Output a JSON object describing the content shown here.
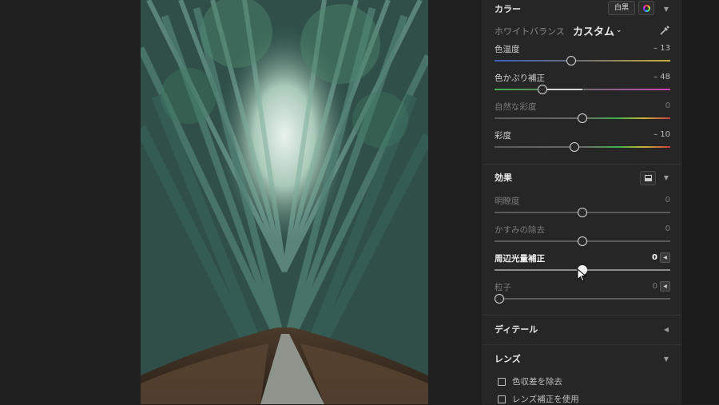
{
  "sections": {
    "color": {
      "title": "カラー",
      "bw_label": "白黒",
      "white_balance": {
        "label": "ホワイトバランス",
        "value": "カスタム"
      },
      "sliders": [
        {
          "label": "色温度",
          "value": "– 13"
        },
        {
          "label": "色かぶり補正",
          "value": "– 48"
        },
        {
          "label": "自然な彩度",
          "value": "0"
        },
        {
          "label": "彩度",
          "value": "– 10"
        }
      ]
    },
    "effects": {
      "title": "効果",
      "sliders": [
        {
          "label": "明瞭度",
          "value": "0"
        },
        {
          "label": "かすみの除去",
          "value": "0"
        },
        {
          "label": "周辺光量補正",
          "value": "0"
        },
        {
          "label": "粒子",
          "value": "0"
        }
      ]
    },
    "detail": {
      "title": "ディテール"
    },
    "lens": {
      "title": "レンズ",
      "options": [
        {
          "label": "色収差を除去",
          "checked": false
        },
        {
          "label": "レンズ補正を使用",
          "checked": false
        }
      ]
    }
  },
  "icons": {
    "color_wheel": "color-wheel-icon",
    "eyedropper": "eyedropper-icon",
    "effects_mask": "effects-mask-icon",
    "collapse": "caret-down-icon",
    "expand": "caret-left-icon",
    "pointer": "mouse-pointer-icon"
  },
  "colors": {
    "panel_bg": "#262626",
    "canvas_bg": "#1f1f1f",
    "active_text": "#f0f0f0",
    "dim_text": "#7a7a7a"
  }
}
